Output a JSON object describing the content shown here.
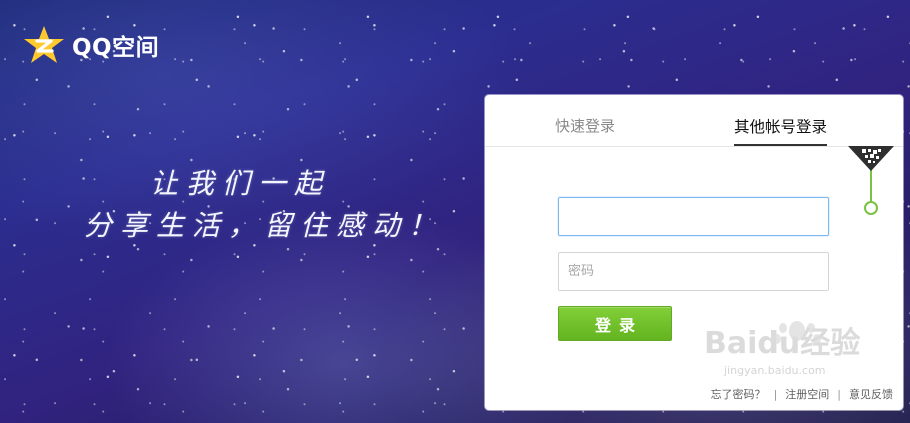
{
  "brand": {
    "logo_text": "QQ空间",
    "icon": "qzone-star-icon"
  },
  "slogan": {
    "line_1": "让我们一起",
    "line_2": "分享生活，留住感动！"
  },
  "login": {
    "tabs": [
      {
        "label": "快速登录"
      },
      {
        "label": "其他帐号登录"
      }
    ],
    "account": {
      "value": "",
      "placeholder": ""
    },
    "password": {
      "value": "",
      "placeholder": "密码"
    },
    "submit_label": "登录",
    "links": {
      "forgot_password": "忘了密码？",
      "register": "注册空间",
      "feedback": "意见反馈"
    },
    "qr_icon": "qr-code-icon"
  },
  "watermark": {
    "brand": "Baidu经验",
    "url": "jingyan.baidu.com"
  },
  "colors": {
    "accent_green": "#6abf2a",
    "logo_yellow": "#ffc82d",
    "focus_blue": "#7fb8f0"
  }
}
